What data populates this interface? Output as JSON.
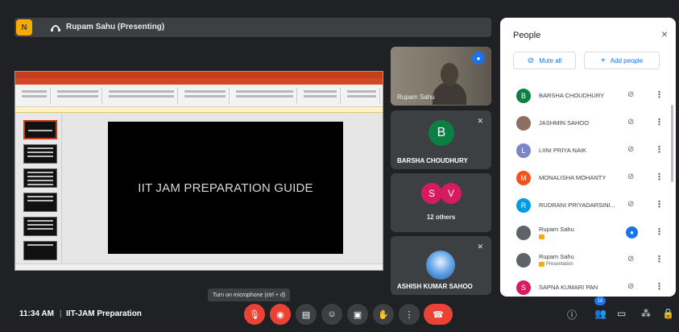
{
  "presenting": {
    "logo_letter": "N",
    "text": "Rupam Sahu (Presenting)"
  },
  "slide": {
    "title": "IIT JAM PREPARATION GUIDE"
  },
  "tiles": {
    "video_name": "Rupam Sahu",
    "barsha": {
      "initial": "B",
      "name": "BARSHA CHOUDHURY",
      "color": "#0b8043"
    },
    "others": {
      "initials": [
        "S",
        "V"
      ],
      "colors": [
        "#d81b60",
        "#d81b60"
      ],
      "label": "12 others"
    },
    "ashish": {
      "name": "ASHISH KUMAR SAHOO"
    }
  },
  "panel": {
    "title": "People",
    "close": "×",
    "mute_all": "Mute all",
    "add_people": "Add people",
    "participants": [
      {
        "initial": "B",
        "color": "#0b8043",
        "name": "BARSHA CHOUDHURY",
        "mic": "off"
      },
      {
        "initial": "",
        "color": "#8d6e63",
        "name": "JASHMIN SAHOO",
        "mic": "off"
      },
      {
        "initial": "L",
        "color": "#7986cb",
        "name": "LIINI PRIYA NAIK",
        "mic": "off"
      },
      {
        "initial": "M",
        "color": "#f4511e",
        "name": "MONALISHA MOHANTY",
        "mic": "off"
      },
      {
        "initial": "R",
        "color": "#039be5",
        "name": "RUDRANI PRIYADARSINI...",
        "mic": "off"
      },
      {
        "initial": "",
        "color": "#5f6368",
        "name": "Rupam Sahu",
        "sub": "",
        "mic": "on"
      },
      {
        "initial": "",
        "color": "#5f6368",
        "name": "Rupam Sahu",
        "sub": "Presentation",
        "mic": "off"
      },
      {
        "initial": "S",
        "color": "#d81b60",
        "name": "SAPNA KUMARI PAN",
        "mic": "off"
      }
    ]
  },
  "bottom": {
    "time": "11:34 AM",
    "separator": "|",
    "meeting": "IIT-JAM Preparation",
    "tooltip": "Turn on microphone (ctrl + d)",
    "participant_count": "16"
  }
}
